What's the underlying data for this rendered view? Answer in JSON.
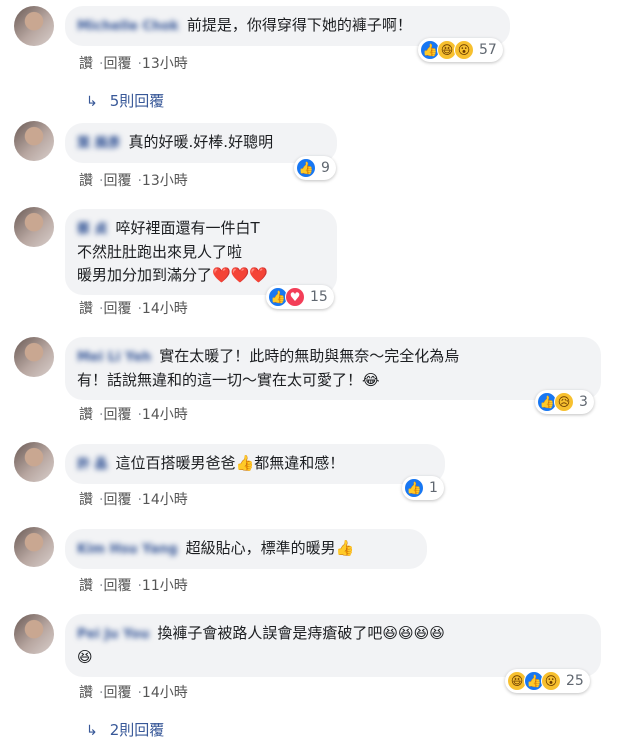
{
  "comments": [
    {
      "name": "Michelle Chok",
      "text": "前提是，你得穿得下她的褲子啊！",
      "actions": {
        "read": "讚",
        "reply": "回覆",
        "time": "13小時"
      },
      "reactions": {
        "icons": [
          "like-icon",
          "haha-icon",
          "wow-icon"
        ],
        "count": "57"
      },
      "replies": "5則回覆"
    },
    {
      "name": "葉 展彥",
      "text": "真的好暖.好棒.好聰明",
      "actions": {
        "read": "讚",
        "reply": "回覆",
        "time": "13小時"
      },
      "reactions": {
        "icons": [
          "like-icon"
        ],
        "count": "9"
      }
    },
    {
      "name": "蔡 貞",
      "text_lines": [
        "啐好裡面還有一件白T",
        "不然肚肚跑出來見人了啦",
        "暖男加分加到滿分了❤️❤️❤️"
      ],
      "actions": {
        "read": "讚",
        "reply": "回覆",
        "time": "14小時"
      },
      "reactions": {
        "icons": [
          "like-icon",
          "love-icon"
        ],
        "count": "15"
      }
    },
    {
      "name": "Mei Li Yeh",
      "text_lines": [
        "實在太暖了！此時的無助與無奈～完全化為烏",
        "有！話說無違和的這一切～實在太可愛了！😂"
      ],
      "actions": {
        "read": "讚",
        "reply": "回覆",
        "time": "14小時"
      },
      "reactions": {
        "icons": [
          "like-icon",
          "sad-icon"
        ],
        "count": "3"
      }
    },
    {
      "name": "許 晶",
      "text": "這位百搭暖男爸爸👍都無違和感！",
      "actions": {
        "read": "讚",
        "reply": "回覆",
        "time": "14小時"
      },
      "reactions": {
        "icons": [
          "like-icon"
        ],
        "count": "1"
      }
    },
    {
      "name": "Kim Hsu Yang",
      "text": "超級貼心，標準的暖男👍",
      "actions": {
        "read": "讚",
        "reply": "回覆",
        "time": "11小時"
      }
    },
    {
      "name": "Pei Ju You",
      "text_lines": [
        "換褲子會被路人誤會是痔瘡破了吧😆😆😆😆",
        "😆"
      ],
      "actions": {
        "read": "讚",
        "reply": "回覆",
        "time": "14小時"
      },
      "reactions": {
        "icons": [
          "haha-icon",
          "like-icon",
          "wow-icon"
        ],
        "count": "25"
      },
      "replies": "2則回覆"
    }
  ]
}
